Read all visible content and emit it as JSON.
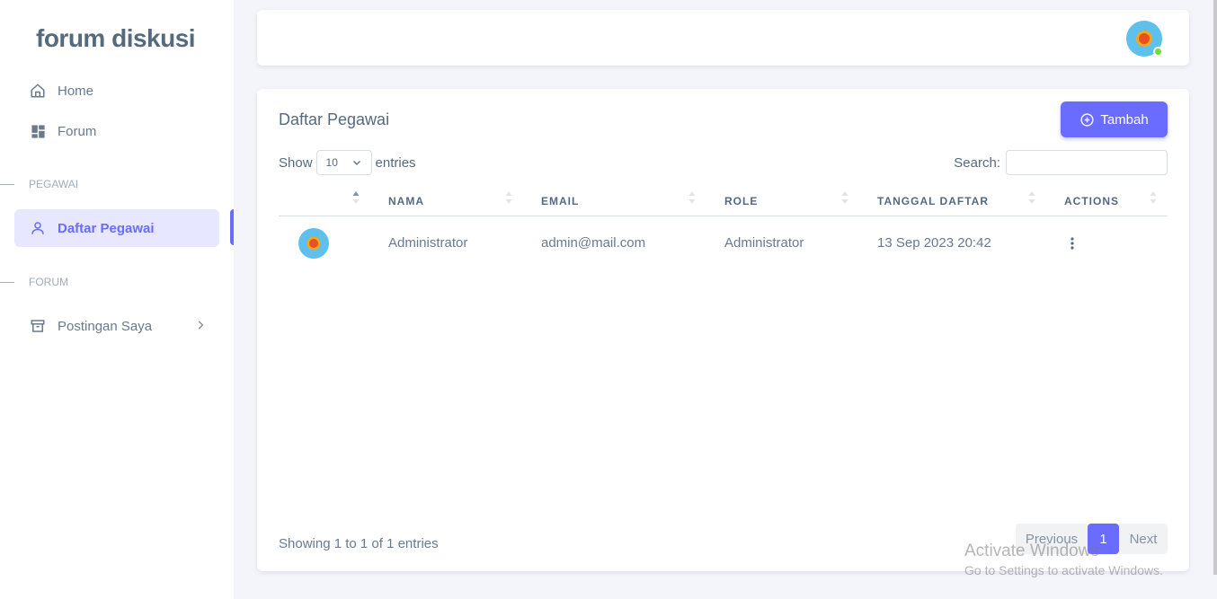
{
  "brand": "forum diskusi",
  "sidebar": {
    "items": [
      {
        "label": "Home",
        "icon": "home-icon"
      },
      {
        "label": "Forum",
        "icon": "dashboard-grid-icon"
      }
    ],
    "sections": [
      {
        "label": "PEGAWAI",
        "items": [
          {
            "label": "Daftar Pegawai",
            "icon": "user-icon",
            "active": true
          }
        ]
      },
      {
        "label": "FORUM",
        "items": [
          {
            "label": "Postingan Saya",
            "icon": "archive-box-icon"
          }
        ]
      }
    ]
  },
  "colors": {
    "accent": "#696cff",
    "active_bg": "#e7e7ff",
    "online": "#71dd37"
  },
  "card": {
    "title": "Daftar Pegawai",
    "add_button": "Tambah",
    "show_label": "Show",
    "entries_label": "entries",
    "page_length": "10",
    "search_label": "Search:",
    "search_value": "",
    "columns": [
      "",
      "NAMA",
      "EMAIL",
      "ROLE",
      "TANGGAL DAFTAR",
      "ACTIONS"
    ],
    "rows": [
      {
        "nama": "Administrator",
        "email": "admin@mail.com",
        "role": "Administrator",
        "tanggal": "13 Sep 2023 20:42"
      }
    ],
    "info": "Showing 1 to 1 of 1 entries",
    "pagination": {
      "previous": "Previous",
      "current": "1",
      "next": "Next"
    }
  },
  "watermark": {
    "line1": "Activate Windows",
    "line2": "Go to Settings to activate Windows."
  }
}
